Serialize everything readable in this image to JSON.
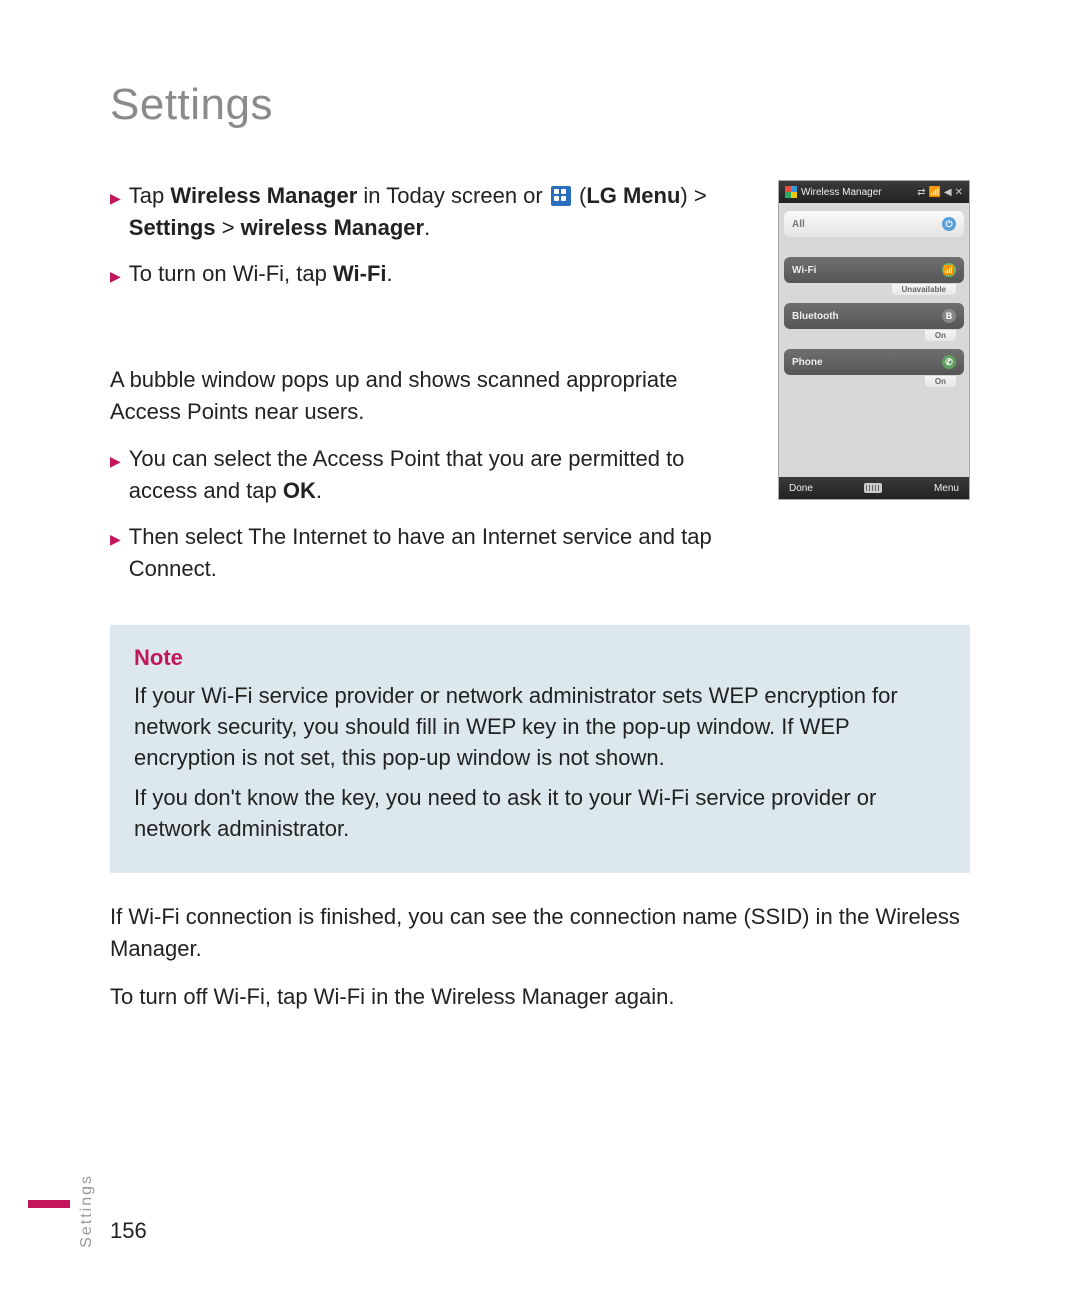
{
  "title": "Settings",
  "bullets_top": [
    {
      "parts": [
        {
          "text": "Tap "
        },
        {
          "text": "Wireless Manager",
          "bold": true
        },
        {
          "text": " in Today screen or "
        },
        {
          "icon": "menu-icon"
        },
        {
          "text": " ("
        },
        {
          "text": "LG Menu",
          "bold": true
        },
        {
          "text": ") > "
        },
        {
          "text": "Settings",
          "bold": true
        },
        {
          "text": " > "
        },
        {
          "text": "wireless Manager",
          "bold": true
        },
        {
          "text": "."
        }
      ]
    },
    {
      "parts": [
        {
          "text": "To turn on Wi-Fi, tap "
        },
        {
          "text": "Wi-Fi",
          "bold": true
        },
        {
          "text": "."
        }
      ]
    }
  ],
  "mid_para": "A bubble window pops up and shows scanned appropriate  Access Points near users.",
  "bullets_mid": [
    {
      "parts": [
        {
          "text": "You can select the Access Point that you are permitted to access and tap "
        },
        {
          "text": "OK",
          "bold": true
        },
        {
          "text": "."
        }
      ]
    },
    {
      "parts": [
        {
          "text": "Then select The Internet to have an Internet service and tap Connect."
        }
      ]
    }
  ],
  "note": {
    "title": "Note",
    "paras": [
      "If your Wi-Fi service provider or network administrator sets WEP encryption for network security, you should fill in WEP key in the pop-up window. If WEP encryption is not set, this pop-up window is not shown.",
      "If you don't know the key, you need to ask it to your Wi-Fi service provider or network administrator."
    ]
  },
  "after_paras": [
    "If  Wi-Fi connection is finished, you can see the connection name (SSID) in the  Wireless Manager.",
    "To turn off Wi-Fi, tap Wi-Fi in the Wireless Manager again."
  ],
  "phone": {
    "title": "Wireless Manager",
    "rows": [
      {
        "label": "All",
        "icon": "power",
        "iconGlyph": "⏻",
        "sub": null
      },
      {
        "label": "Wi-Fi",
        "icon": "wifi",
        "iconGlyph": "📶",
        "sub": "Unavailable"
      },
      {
        "label": "Bluetooth",
        "icon": "bt",
        "iconGlyph": "B",
        "sub": "On"
      },
      {
        "label": "Phone",
        "icon": "phone",
        "iconGlyph": "✆",
        "sub": "On"
      }
    ],
    "softkeys": {
      "left": "Done",
      "right": "Menu"
    }
  },
  "footer": {
    "tab": "Settings",
    "page": "156"
  }
}
